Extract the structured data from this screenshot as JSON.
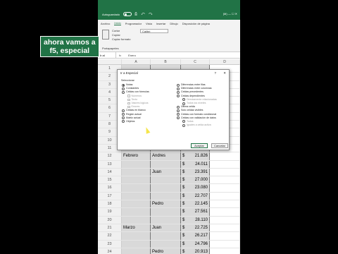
{
  "titlebar": {
    "autosave_label": "Autoguardado",
    "qa_icons": "⎙ ↶ ↷",
    "window_controls": "(M) —  ☐  ✕"
  },
  "ribbon": {
    "tabs": [
      "Archivo",
      "Inicio",
      "Programador",
      "Vista",
      "Insertar",
      "Dibujo",
      "Disposición de página"
    ],
    "active_tab": "Inicio",
    "clipboard": [
      "Cortar",
      "Copiar",
      "Copiar formato"
    ],
    "font_name": "Calibri",
    "group_label": "Portapapeles"
  },
  "callout": {
    "line1": "ahora vamos a",
    "line2": "f5, especial"
  },
  "formula_bar": {
    "name_box": "Ir al",
    "fx": "fx",
    "value": "Enero"
  },
  "columns": [
    "A",
    "B",
    "C",
    "D"
  ],
  "rows": [
    {
      "num": "1",
      "a": "",
      "b": "",
      "cur": "",
      "val": ""
    },
    {
      "num": "2",
      "a": "",
      "b": "",
      "cur": "",
      "val": ""
    },
    {
      "num": "3",
      "a": "",
      "b": "",
      "cur": "",
      "val": ""
    },
    {
      "num": "4",
      "a": "",
      "b": "",
      "cur": "",
      "val": ""
    },
    {
      "num": "5",
      "a": "",
      "b": "",
      "cur": "",
      "val": ""
    },
    {
      "num": "6",
      "a": "",
      "b": "",
      "cur": "",
      "val": ""
    },
    {
      "num": "7",
      "a": "",
      "b": "",
      "cur": "",
      "val": ""
    },
    {
      "num": "8",
      "a": "",
      "b": "",
      "cur": "",
      "val": ""
    },
    {
      "num": "9",
      "a": "",
      "b": "",
      "cur": "",
      "val": ""
    },
    {
      "num": "10",
      "a": "",
      "b": "",
      "cur": "",
      "val": ""
    },
    {
      "num": "11",
      "a": "",
      "b": "",
      "cur": "",
      "val": ""
    },
    {
      "num": "12",
      "a": "Febrero",
      "b": "Andres",
      "cur": "$",
      "val": "21.826"
    },
    {
      "num": "13",
      "a": "",
      "b": "",
      "cur": "$",
      "val": "24.011"
    },
    {
      "num": "14",
      "a": "",
      "b": "Juan",
      "cur": "$",
      "val": "23.391"
    },
    {
      "num": "15",
      "a": "",
      "b": "",
      "cur": "$",
      "val": "27.000"
    },
    {
      "num": "16",
      "a": "",
      "b": "",
      "cur": "$",
      "val": "23.080"
    },
    {
      "num": "17",
      "a": "",
      "b": "",
      "cur": "$",
      "val": "22.707"
    },
    {
      "num": "18",
      "a": "",
      "b": "Pedro",
      "cur": "$",
      "val": "22.145"
    },
    {
      "num": "19",
      "a": "",
      "b": "",
      "cur": "$",
      "val": "27.561"
    },
    {
      "num": "20",
      "a": "",
      "b": "",
      "cur": "$",
      "val": "28.110"
    },
    {
      "num": "21",
      "a": "Marzo",
      "b": "Juan",
      "cur": "$",
      "val": "22.725"
    },
    {
      "num": "22",
      "a": "",
      "b": "",
      "cur": "$",
      "val": "26.217"
    },
    {
      "num": "23",
      "a": "",
      "b": "",
      "cur": "$",
      "val": "24.796"
    },
    {
      "num": "24",
      "a": "",
      "b": "Pedro",
      "cur": "$",
      "val": "20.913"
    },
    {
      "num": "25",
      "a": "",
      "b": "",
      "cur": "$",
      "val": "29.519"
    }
  ],
  "dialog": {
    "title": "Ir a Especial",
    "help": "?",
    "close": "✕",
    "section": "Seleccionar",
    "left_options": [
      {
        "label": "Notas",
        "type": "radio",
        "selected": true
      },
      {
        "label": "Constantes",
        "type": "radio",
        "selected": false
      },
      {
        "label": "Celdas con fórmulas",
        "type": "radio",
        "selected": false
      },
      {
        "label": "Números",
        "type": "check",
        "selected": false
      },
      {
        "label": "Texto",
        "type": "check",
        "selected": false
      },
      {
        "label": "Valores lógicos",
        "type": "check",
        "selected": false
      },
      {
        "label": "Errores",
        "type": "check",
        "selected": false
      },
      {
        "label": "Celdas en blanco",
        "type": "radio",
        "selected": false
      },
      {
        "label": "Región actual",
        "type": "radio",
        "selected": false
      },
      {
        "label": "Matriz actual",
        "type": "radio",
        "selected": false
      },
      {
        "label": "Objetos",
        "type": "radio",
        "selected": false
      }
    ],
    "right_options": [
      {
        "label": "Diferencias entre filas",
        "type": "radio",
        "selected": false
      },
      {
        "label": "Diferencias entre columnas",
        "type": "radio",
        "selected": false
      },
      {
        "label": "Celdas precedentes",
        "type": "radio",
        "selected": false
      },
      {
        "label": "Celdas dependientes",
        "type": "radio",
        "selected": false
      },
      {
        "label": "Directamente relacionadas",
        "type": "radio-sub",
        "selected": false
      },
      {
        "label": "Todos los niveles",
        "type": "radio-sub",
        "selected": false
      },
      {
        "label": "Última celda",
        "type": "radio",
        "selected": false
      },
      {
        "label": "Solo celdas visibles",
        "type": "radio",
        "selected": false
      },
      {
        "label": "Celdas con formato condicional",
        "type": "radio",
        "selected": false
      },
      {
        "label": "Celdas con validación de datos",
        "type": "radio",
        "selected": false
      },
      {
        "label": "Todos",
        "type": "radio-sub",
        "selected": false
      },
      {
        "label": "Iguales a celda activa",
        "type": "radio-sub",
        "selected": false
      }
    ],
    "ok_label": "Aceptar",
    "cancel_label": "Cancelar"
  }
}
